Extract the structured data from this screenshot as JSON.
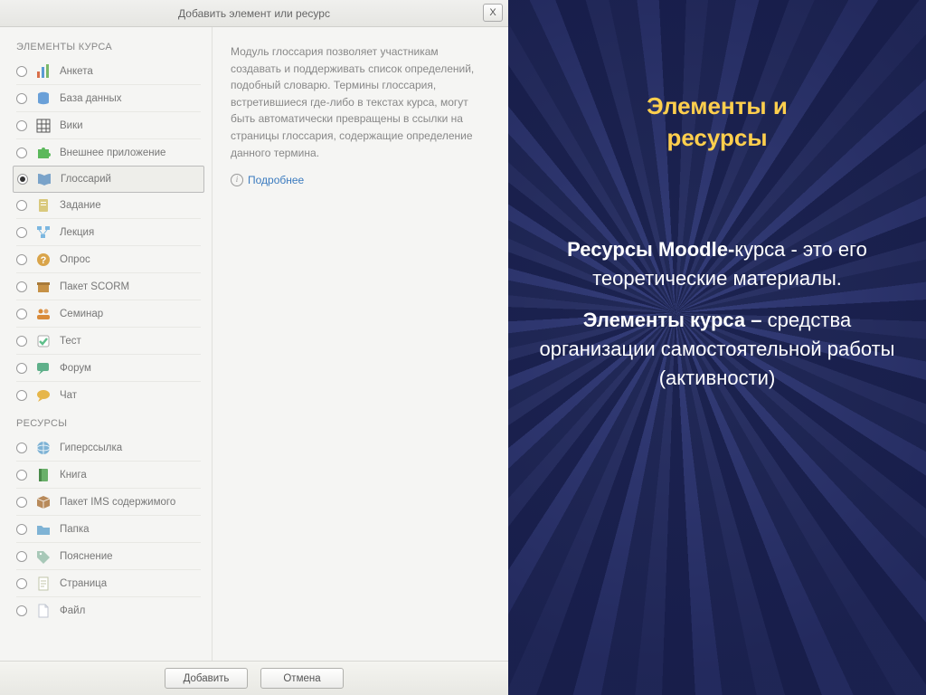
{
  "dialog": {
    "title": "Добавить элемент или ресурс",
    "close_label": "X",
    "sections": {
      "elements_title": "ЭЛЕМЕНТЫ КУРСА",
      "resources_title": "РЕСУРСЫ"
    },
    "elements": [
      {
        "id": "anketa",
        "label": "Анкета",
        "icon": "bar-chart",
        "color": "#e8a23a",
        "selected": false
      },
      {
        "id": "baza",
        "label": "База данных",
        "icon": "database",
        "color": "#6aa0d8",
        "selected": false
      },
      {
        "id": "wiki",
        "label": "Вики",
        "icon": "grid",
        "color": "#555",
        "selected": false
      },
      {
        "id": "external",
        "label": "Внешнее приложение",
        "icon": "puzzle",
        "color": "#5cb85c",
        "selected": false
      },
      {
        "id": "glossary",
        "label": "Глоссарий",
        "icon": "book-open",
        "color": "#7aa3c9",
        "selected": true
      },
      {
        "id": "task",
        "label": "Задание",
        "icon": "document",
        "color": "#d9c97d",
        "selected": false
      },
      {
        "id": "lecture",
        "label": "Лекция",
        "icon": "flow",
        "color": "#7cb7e0",
        "selected": false
      },
      {
        "id": "survey",
        "label": "Опрос",
        "icon": "question",
        "color": "#d9a44a",
        "selected": false
      },
      {
        "id": "scorm",
        "label": "Пакет SCORM",
        "icon": "box",
        "color": "#c69146",
        "selected": false
      },
      {
        "id": "seminar",
        "label": "Семинар",
        "icon": "people",
        "color": "#d98b3a",
        "selected": false
      },
      {
        "id": "test",
        "label": "Тест",
        "icon": "check",
        "color": "#5fbf8a",
        "selected": false
      },
      {
        "id": "forum",
        "label": "Форум",
        "icon": "speech",
        "color": "#5fb08a",
        "selected": false
      },
      {
        "id": "chat",
        "label": "Чат",
        "icon": "chat",
        "color": "#e6b64a",
        "selected": false
      }
    ],
    "resources": [
      {
        "id": "link",
        "label": "Гиперссылка",
        "icon": "globe",
        "color": "#7fb3d5"
      },
      {
        "id": "book",
        "label": "Книга",
        "icon": "book",
        "color": "#6ab06a"
      },
      {
        "id": "ims",
        "label": "Пакет IMS содержимого",
        "icon": "package",
        "color": "#b88a5a"
      },
      {
        "id": "folder",
        "label": "Папка",
        "icon": "folder",
        "color": "#7fb3d5"
      },
      {
        "id": "label",
        "label": "Пояснение",
        "icon": "tag",
        "color": "#a8c8b8"
      },
      {
        "id": "page",
        "label": "Страница",
        "icon": "page",
        "color": "#c0c5a8"
      },
      {
        "id": "file",
        "label": "Файл",
        "icon": "file",
        "color": "#c0c5d0"
      }
    ],
    "description": "Модуль глоссария позволяет участникам создавать и поддерживать список определений, подобный словарю. Термины глоссария, встретившиеся где-либо в текстах курса, могут быть автоматически превращены в ссылки на страницы глоссария, содержащие определение данного термина.",
    "more_link": "Подробнее",
    "buttons": {
      "add": "Добавить",
      "cancel": "Отмена"
    }
  },
  "slide": {
    "title_l1": "Элементы и",
    "title_l2": "ресурсы",
    "body_p1_bold": "Ресурсы Moodle-",
    "body_p1_rest": "курса - это его теоретические материалы.",
    "body_p2_bold": "Элементы курса – ",
    "body_p2_rest": "средства организации самостоятельной работы (активности)"
  }
}
